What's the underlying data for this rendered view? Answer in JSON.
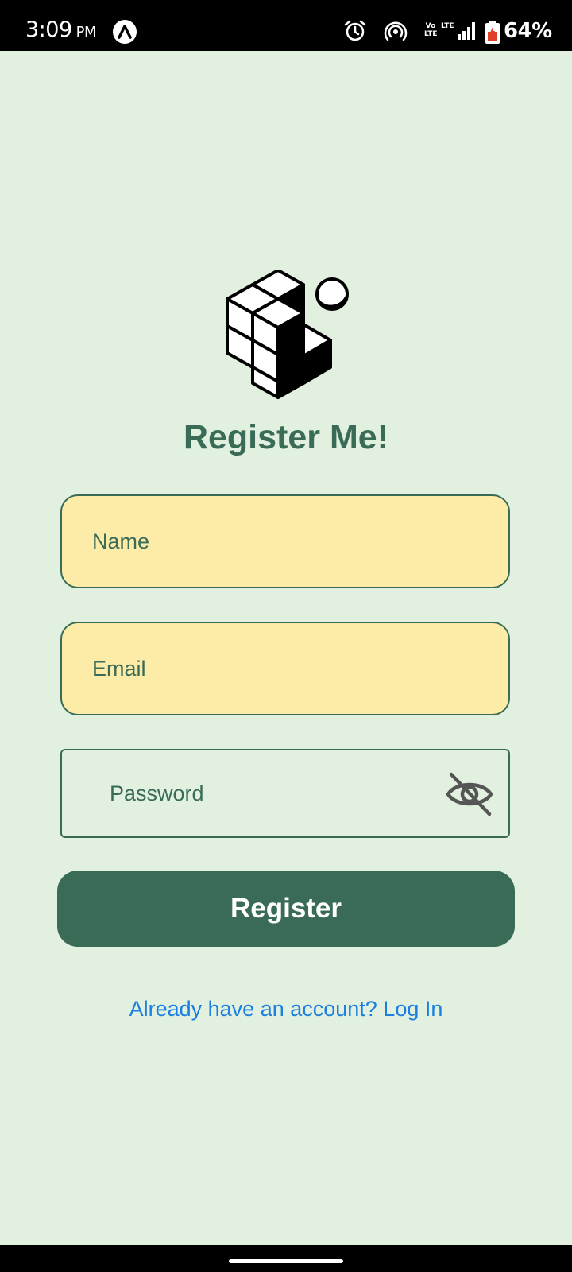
{
  "status_bar": {
    "time": "3:09",
    "ampm": "PM",
    "app_icon": "triangle-app-icon",
    "volte": "Vo\nLTE",
    "lte": "LTE",
    "battery_percent": "64%"
  },
  "logo": {
    "icon": "cube-blocks-logo"
  },
  "title": "Register Me!",
  "form": {
    "name_placeholder": "Name",
    "email_placeholder": "Email",
    "password_placeholder": "Password",
    "password_visibility_icon": "eye-off-icon"
  },
  "register_button_label": "Register",
  "login_link": "Already have an account? Log In",
  "colors": {
    "background": "#e2f0e0",
    "primary": "#3a6b57",
    "field_fill": "#fdeca8",
    "link": "#1a7fe0"
  }
}
